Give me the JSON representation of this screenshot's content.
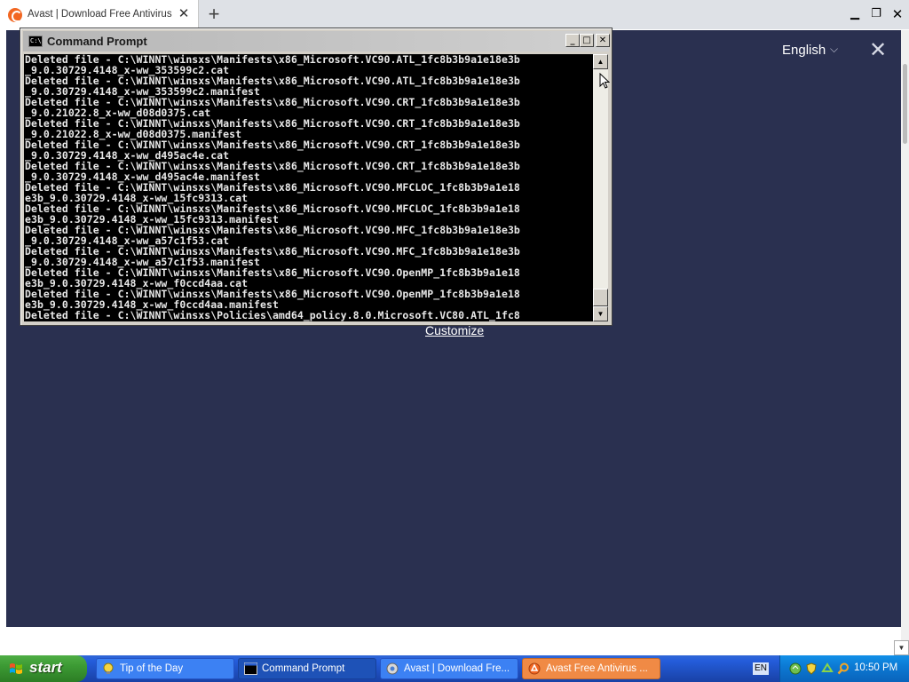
{
  "browser": {
    "tab_title": "Avast | Download Free Antivirus f",
    "tab_close": "✕",
    "new_tab": "+",
    "window_controls": {
      "minimize": "▁",
      "maximize": "❐",
      "close": "✕"
    }
  },
  "page": {
    "language": "English",
    "language_chevron": "⌵",
    "close": "✕",
    "customize": "Customize"
  },
  "cmd": {
    "title": "Command Prompt",
    "icon_text": "C:\\",
    "controls": {
      "minimize": "_",
      "maximize": "□",
      "close": "✕"
    },
    "lines": [
      "Deleted file - C:\\WINNT\\winsxs\\Manifests\\x86_Microsoft.VC90.ATL_1fc8b3b9a1e18e3b",
      "_9.0.30729.4148_x-ww_353599c2.cat",
      "Deleted file - C:\\WINNT\\winsxs\\Manifests\\x86_Microsoft.VC90.ATL_1fc8b3b9a1e18e3b",
      "_9.0.30729.4148_x-ww_353599c2.manifest",
      "Deleted file - C:\\WINNT\\winsxs\\Manifests\\x86_Microsoft.VC90.CRT_1fc8b3b9a1e18e3b",
      "_9.0.21022.8_x-ww_d08d0375.cat",
      "Deleted file - C:\\WINNT\\winsxs\\Manifests\\x86_Microsoft.VC90.CRT_1fc8b3b9a1e18e3b",
      "_9.0.21022.8_x-ww_d08d0375.manifest",
      "Deleted file - C:\\WINNT\\winsxs\\Manifests\\x86_Microsoft.VC90.CRT_1fc8b3b9a1e18e3b",
      "_9.0.30729.4148_x-ww_d495ac4e.cat",
      "Deleted file - C:\\WINNT\\winsxs\\Manifests\\x86_Microsoft.VC90.CRT_1fc8b3b9a1e18e3b",
      "_9.0.30729.4148_x-ww_d495ac4e.manifest",
      "Deleted file - C:\\WINNT\\winsxs\\Manifests\\x86_Microsoft.VC90.MFCLOC_1fc8b3b9a1e18",
      "e3b_9.0.30729.4148_x-ww_15fc9313.cat",
      "Deleted file - C:\\WINNT\\winsxs\\Manifests\\x86_Microsoft.VC90.MFCLOC_1fc8b3b9a1e18",
      "e3b_9.0.30729.4148_x-ww_15fc9313.manifest",
      "Deleted file - C:\\WINNT\\winsxs\\Manifests\\x86_Microsoft.VC90.MFC_1fc8b3b9a1e18e3b",
      "_9.0.30729.4148_x-ww_a57c1f53.cat",
      "Deleted file - C:\\WINNT\\winsxs\\Manifests\\x86_Microsoft.VC90.MFC_1fc8b3b9a1e18e3b",
      "_9.0.30729.4148_x-ww_a57c1f53.manifest",
      "Deleted file - C:\\WINNT\\winsxs\\Manifests\\x86_Microsoft.VC90.OpenMP_1fc8b3b9a1e18",
      "e3b_9.0.30729.4148_x-ww_f0ccd4aa.cat",
      "Deleted file - C:\\WINNT\\winsxs\\Manifests\\x86_Microsoft.VC90.OpenMP_1fc8b3b9a1e18",
      "e3b_9.0.30729.4148_x-ww_f0ccd4aa.manifest",
      "Deleted file - C:\\WINNT\\winsxs\\Policies\\amd64_policy.8.0.Microsoft.VC80.ATL_1fc8"
    ],
    "scroll_up": "▲",
    "scroll_down": "▼"
  },
  "taskbar": {
    "start": "start",
    "tasks": [
      {
        "label": "Tip of the Day"
      },
      {
        "label": "Command Prompt"
      },
      {
        "label": "Avast | Download Fre..."
      },
      {
        "label": "Avast Free Antivirus ..."
      }
    ],
    "language_indicator": "EN",
    "clock": "10:50 PM"
  },
  "colors": {
    "page_background": "#2a3050",
    "active_task": "#f08a45",
    "taskbar": "#245ddb"
  },
  "icons": [
    "avast-favicon",
    "close-icon",
    "plus-icon",
    "chevron-down-icon",
    "cmd-icon",
    "windows-logo-icon",
    "shield-icon",
    "clock"
  ]
}
